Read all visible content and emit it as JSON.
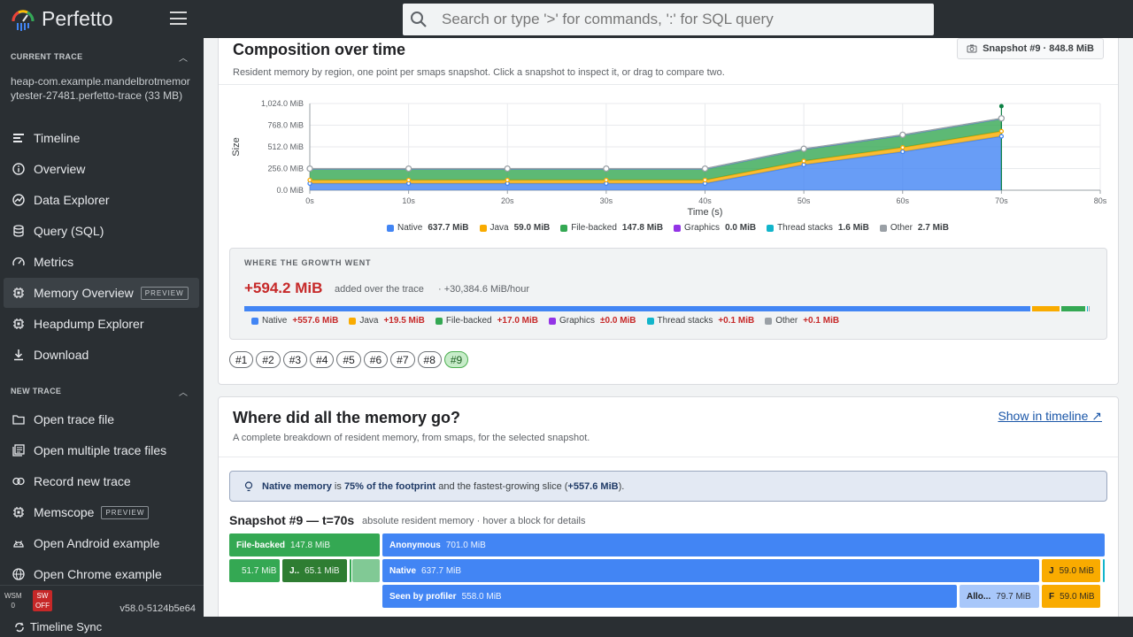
{
  "app": {
    "title": "Perfetto",
    "version": "v58.0-5124b5e64"
  },
  "search": {
    "placeholder": "Search or type '>' for commands, ':' for SQL query"
  },
  "sidebar": {
    "current_trace_header": "CURRENT TRACE",
    "trace_name": "heap-com.example.mandelbrotmemorytester-27481.perfetto-trace (33 MB)",
    "items": [
      {
        "label": "Timeline",
        "icon": "timeline-icon"
      },
      {
        "label": "Overview",
        "icon": "info-icon"
      },
      {
        "label": "Data Explorer",
        "icon": "explore-icon"
      },
      {
        "label": "Query (SQL)",
        "icon": "database-icon"
      },
      {
        "label": "Metrics",
        "icon": "speed-icon"
      },
      {
        "label": "Memory Overview",
        "icon": "memory-icon",
        "badge": "PREVIEW",
        "active": true
      },
      {
        "label": "Heapdump Explorer",
        "icon": "memory-icon"
      },
      {
        "label": "Download",
        "icon": "download-icon"
      }
    ],
    "new_trace_header": "NEW TRACE",
    "new_items": [
      {
        "label": "Open trace file",
        "icon": "folder-icon"
      },
      {
        "label": "Open multiple trace files",
        "icon": "library-icon"
      },
      {
        "label": "Record new trace",
        "icon": "record-icon"
      },
      {
        "label": "Memscope",
        "icon": "memory-icon",
        "badge": "PREVIEW"
      },
      {
        "label": "Open Android example",
        "icon": "android-icon"
      },
      {
        "label": "Open Chrome example",
        "icon": "globe-icon"
      }
    ],
    "footer": {
      "wsm_label": "WSM",
      "wsm_value": "0",
      "sw_label": "SW",
      "sw_value": "OFF"
    }
  },
  "statusbar": {
    "label": "Timeline Sync"
  },
  "composition": {
    "title": "Composition over time",
    "subtitle": "Resident memory by region, one point per smaps snapshot. Click a snapshot to inspect it, or drag to compare two.",
    "snapshot_button": "Snapshot #9 · 848.8 MiB"
  },
  "chart_data": {
    "type": "area",
    "stacked": true,
    "x": [
      0,
      10,
      20,
      30,
      40,
      50,
      60,
      70
    ],
    "xlim": [
      0,
      80
    ],
    "xticks": [
      "0s",
      "10s",
      "20s",
      "30s",
      "40s",
      "50s",
      "60s",
      "70s",
      "80s"
    ],
    "ylim": [
      0,
      1024
    ],
    "yticks": [
      "0.0 MiB",
      "256.0 MiB",
      "512.0 MiB",
      "768.0 MiB",
      "1,024.0 MiB"
    ],
    "xlabel": "Time (s)",
    "ylabel": "Size",
    "grid": true,
    "legend": "bottom",
    "selected_x": 70,
    "series": [
      {
        "name": "Native",
        "color": "#4285f4",
        "values": [
          80,
          80,
          80,
          80,
          80,
          300,
          455,
          637.7
        ]
      },
      {
        "name": "Java",
        "color": "#f9ab00",
        "values": [
          40,
          40,
          40,
          40,
          40,
          45,
          50,
          59.0
        ]
      },
      {
        "name": "File-backed",
        "color": "#34a853",
        "values": [
          131,
          131,
          131,
          131,
          131,
          140,
          145,
          147.8
        ]
      },
      {
        "name": "Graphics",
        "color": "#9334e6",
        "values": [
          0,
          0,
          0,
          0,
          0,
          0,
          0,
          0
        ]
      },
      {
        "name": "Thread stacks",
        "color": "#12b5cb",
        "values": [
          1.5,
          1.5,
          1.5,
          1.5,
          1.5,
          1.6,
          1.6,
          1.6
        ]
      },
      {
        "name": "Other",
        "color": "#9aa0a6",
        "values": [
          2.5,
          2.5,
          2.5,
          2.5,
          2.5,
          2.6,
          2.7,
          2.7
        ]
      }
    ],
    "legend_values": [
      "637.7 MiB",
      "59.0 MiB",
      "147.8 MiB",
      "0.0 MiB",
      "1.6 MiB",
      "2.7 MiB"
    ]
  },
  "growth": {
    "header": "WHERE THE GROWTH WENT",
    "total": "+594.2 MiB",
    "added": "added over the trace",
    "rate": "· +30,384.6 MiB/hour",
    "items": [
      {
        "name": "Native",
        "value": "+557.6 MiB",
        "color": "#4285f4",
        "amount": 557.6
      },
      {
        "name": "Java",
        "value": "+19.5 MiB",
        "color": "#f9ab00",
        "amount": 19.5
      },
      {
        "name": "File-backed",
        "value": "+17.0 MiB",
        "color": "#34a853",
        "amount": 17.0
      },
      {
        "name": "Graphics",
        "value": "±0.0 MiB",
        "color": "#9334e6",
        "amount": 0
      },
      {
        "name": "Thread stacks",
        "value": "+0.1 MiB",
        "color": "#12b5cb",
        "amount": 0.1
      },
      {
        "name": "Other",
        "value": "+0.1 MiB",
        "color": "#9aa0a6",
        "amount": 0.1
      }
    ]
  },
  "snapshots": [
    "#1",
    "#2",
    "#3",
    "#4",
    "#5",
    "#6",
    "#7",
    "#8",
    "#9"
  ],
  "breakdown": {
    "title": "Where did all the memory go?",
    "show_timeline": "Show in timeline ↗",
    "subtitle": "A complete breakdown of resident memory, from smaps, for the selected snapshot.",
    "insight": {
      "p1": "Native memory",
      "p2": " is ",
      "p3": "75% of the footprint",
      "p4": " and the fastest-growing slice (",
      "p5": "+557.6 MiB",
      "p6": ")."
    },
    "snap_title": "Snapshot #9 — t=70s",
    "snap_sub": "absolute resident memory · hover a block for details",
    "blocks": {
      "fb": {
        "name": "File-backed",
        "val": "147.8 MiB"
      },
      "anon": {
        "name": "Anonymous",
        "val": "701.0 MiB"
      },
      "fb1": {
        "name": "",
        "val": "51.7 MiB"
      },
      "fb2": {
        "name": "J..",
        "val": "65.1 MiB"
      },
      "native": {
        "name": "Native",
        "val": "637.7 MiB"
      },
      "java": {
        "name": "J",
        "val": "59.0 MiB"
      },
      "seen": {
        "name": "Seen by profiler",
        "val": "558.0 MiB"
      },
      "allo": {
        "name": "Allo...",
        "val": "79.7 MiB"
      },
      "f": {
        "name": "F",
        "val": "59.0 MiB"
      }
    }
  }
}
